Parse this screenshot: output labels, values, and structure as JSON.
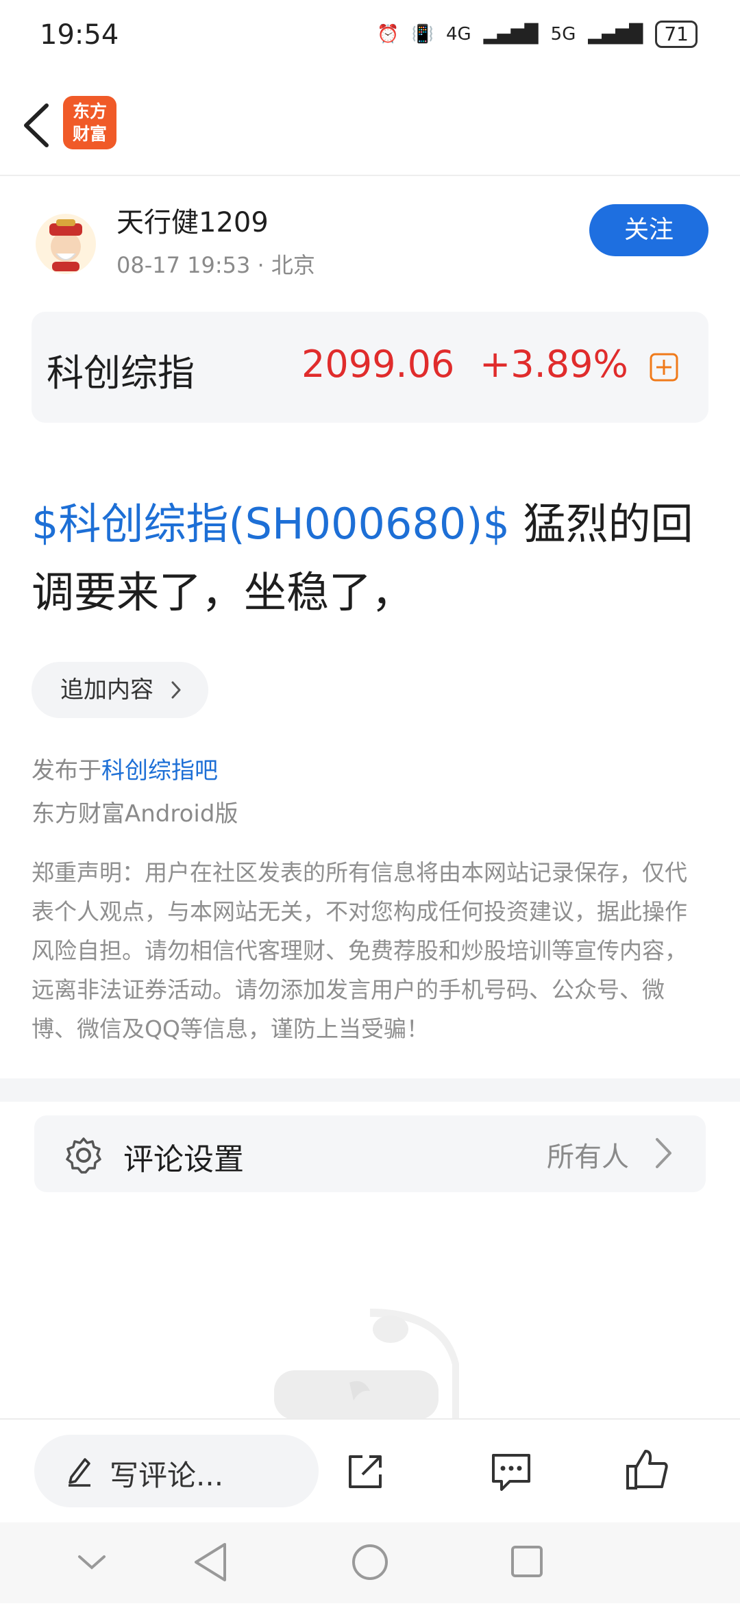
{
  "status_bar": {
    "time": "19:54",
    "network_4g": "4G",
    "network_5g": "5G",
    "battery": "71"
  },
  "nav": {
    "logo_line1": "东方",
    "logo_line2": "财富"
  },
  "author": {
    "name": "天行健1209",
    "meta": "08-17 19:53 · 北京",
    "follow_label": "关注"
  },
  "stock": {
    "name": "科创综指",
    "price": "2099.06",
    "change": "+3.89%"
  },
  "post": {
    "tag": "$科创综指(SH000680)$",
    "text_line1": "猛烈的回",
    "text_line2": "调要来了，坐稳了，"
  },
  "append_label": "追加内容",
  "published": {
    "prefix": "发布于",
    "bar": "科创综指吧"
  },
  "client": "东方财富Android版",
  "disclaimer": "郑重声明：用户在社区发表的所有信息将由本网站记录保存，仅代表个人观点，与本网站无关，不对您构成任何投资建议，据此操作风险自担。请勿相信代客理财、免费荐股和炒股培训等宣传内容，远离非法证券活动。请勿添加发言用户的手机号码、公众号、微博、微信及QQ等信息，谨防上当受骗！",
  "comment_setting": {
    "label": "评论设置",
    "value": "所有人"
  },
  "bottom_bar": {
    "write_label": "写评论..."
  },
  "colors": {
    "accent_blue": "#1e6fe0",
    "stock_red": "#e02c2c",
    "brand_orange": "#f05a28"
  }
}
